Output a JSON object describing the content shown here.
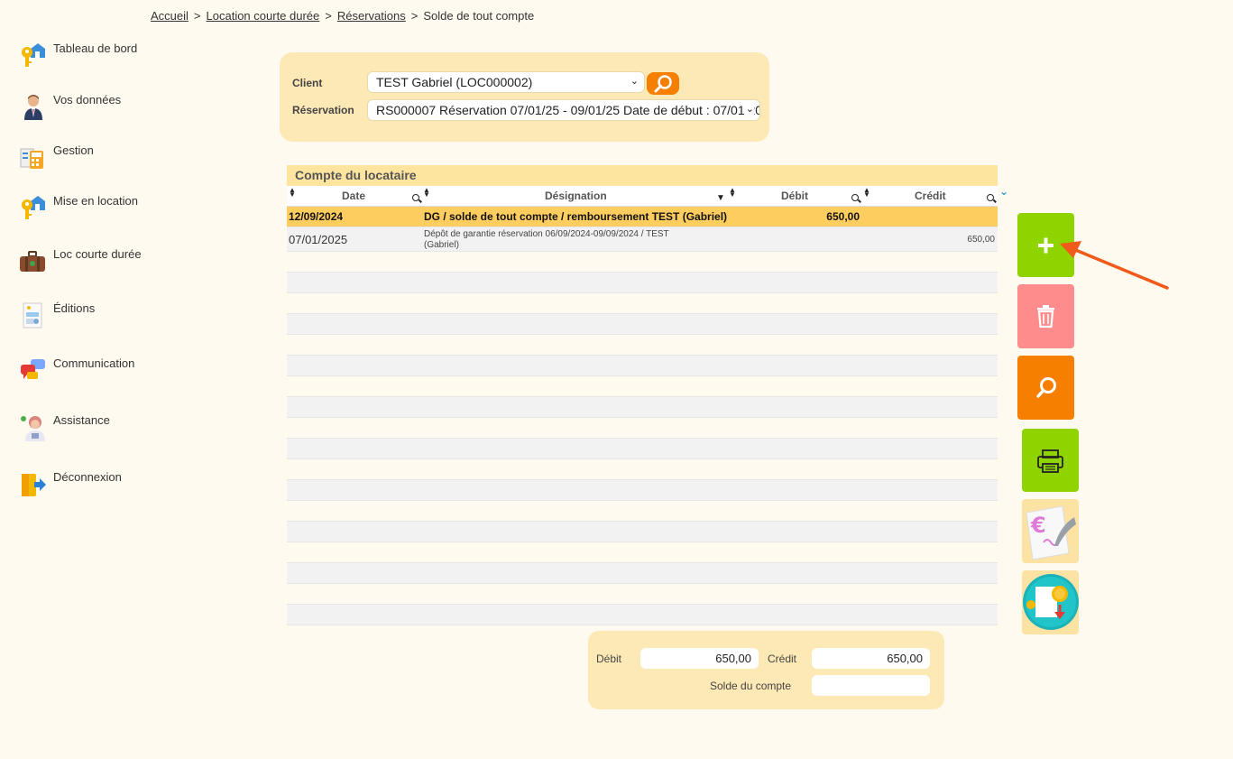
{
  "breadcrumb": {
    "home": "Accueil",
    "section": "Location courte durée",
    "subsection": "Réservations",
    "current": "Solde de tout compte",
    "separator": ">"
  },
  "sidebar": {
    "items": [
      {
        "label": "Tableau de bord",
        "icon": "keys-house-icon"
      },
      {
        "label": "Vos données",
        "icon": "user-icon"
      },
      {
        "label": "Gestion",
        "icon": "calculator-icon"
      },
      {
        "label": "Mise en location",
        "icon": "keys-house-icon"
      },
      {
        "label": "Loc courte durée",
        "icon": "suitcase-icon"
      },
      {
        "label": "Éditions",
        "icon": "report-icon"
      },
      {
        "label": "Communication",
        "icon": "chat-bubbles-icon"
      },
      {
        "label": "Assistance",
        "icon": "support-agent-icon"
      },
      {
        "label": "Déconnexion",
        "icon": "logout-icon"
      }
    ]
  },
  "filters": {
    "client_label": "Client",
    "client_value": "TEST Gabriel (LOC000002)",
    "reservation_label": "Réservation",
    "reservation_value": "RS000007 Réservation 07/01/25 - 09/01/25 Date de début : 07/01/20"
  },
  "grid": {
    "title": "Compte du locataire",
    "columns": [
      "Date",
      "Désignation",
      "Débit",
      "Crédit"
    ],
    "rows": [
      {
        "date": "12/09/2024",
        "designation": "DG / solde de tout compte / remboursement TEST (Gabriel)",
        "debit": "650,00",
        "credit": "",
        "selected": true
      },
      {
        "date": "07/01/2025",
        "designation": "Dépôt de garantie réservation 06/09/2024-09/09/2024 / TEST (Gabriel)",
        "debit": "",
        "credit": "650,00",
        "selected": false
      }
    ]
  },
  "actions": [
    {
      "name": "add-button",
      "icon": "plus-icon",
      "color": "#8fd400"
    },
    {
      "name": "delete-button",
      "icon": "trash-icon",
      "color": "#ff8c8c"
    },
    {
      "name": "search-button",
      "icon": "search-icon",
      "color": "#f77f00"
    },
    {
      "name": "print-button",
      "icon": "printer-icon",
      "color": "#8fd400"
    },
    {
      "name": "payment-button",
      "icon": "euro-quill-icon",
      "color": "#fde3a3"
    },
    {
      "name": "refund-button",
      "icon": "coins-download-icon",
      "color": "#fde3a3"
    }
  ],
  "totals": {
    "debit_label": "Débit",
    "debit_value": "650,00",
    "credit_label": "Crédit",
    "credit_value": "650,00",
    "balance_label": "Solde du compte",
    "balance_value": ""
  },
  "colors": {
    "background": "#fffaf0",
    "panel": "#fde9b6",
    "selected_row": "#fecd5f",
    "accent_orange": "#f77f00",
    "accent_green": "#8fd400",
    "arrow": "#f05a1a"
  }
}
